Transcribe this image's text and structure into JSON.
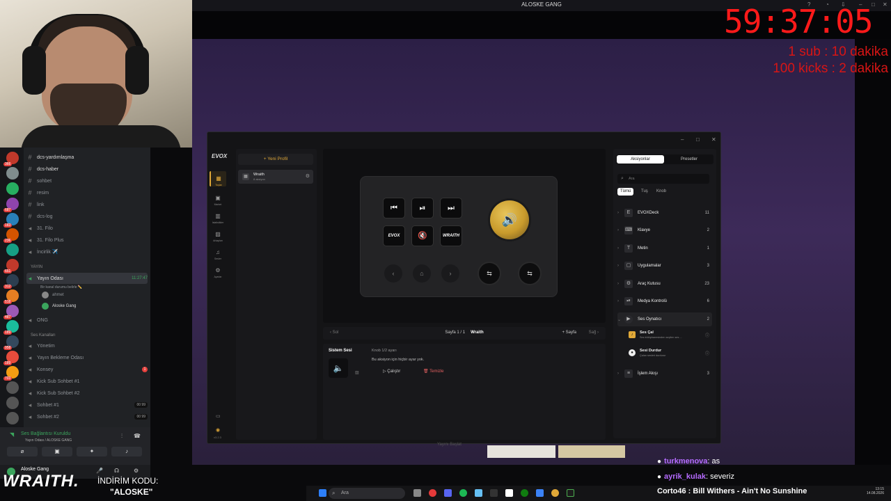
{
  "window_title": "ALOSKE GANG",
  "overlay": {
    "timer": "59:37:05",
    "sub_line1": "1 sub : 10 dakika",
    "sub_line2": "100 kicks : 2 dakika",
    "promo_brand": "WRAITH.",
    "promo_text1": "İNDİRİM KODU:",
    "promo_text2": "\"ALOSKE\"",
    "chat": [
      {
        "user": "turkmenova",
        "msg": ": as"
      },
      {
        "user": "ayrik_kulak",
        "msg": ": severiz"
      }
    ],
    "now_playing": "Corto46 : Bill Withers - Ain't No Sunshine",
    "clock_time": "13:15",
    "clock_date": "14.08.2026",
    "taskbar_search": "Ara"
  },
  "discord": {
    "server_badges": [
      "366",
      "",
      "",
      "687",
      "183",
      "236",
      "",
      "651",
      "312",
      "518",
      "487",
      "189",
      "958",
      "189",
      "703",
      "",
      "",
      ""
    ],
    "channels": [
      {
        "name": "dcs-yardımlaşma",
        "bold": true
      },
      {
        "name": "dcs-haber",
        "bold": true
      },
      {
        "name": "sohbet"
      },
      {
        "name": "resim"
      },
      {
        "name": "link"
      },
      {
        "name": "dcs-log"
      },
      {
        "name": "31. Filo"
      },
      {
        "name": "31. Filo Plus"
      },
      {
        "name": "İncirlik ✈️"
      }
    ],
    "category_live": "YAYIN",
    "live_channel": "Yayın Odası",
    "live_time": "11:27:47",
    "live_status": "Bir kanal durumu belirle ✏️",
    "live_users": [
      "ahmet",
      "Aloske Gang"
    ],
    "ong": "ONG",
    "category_voice": "Ses Kanalları",
    "voice_channels": [
      {
        "name": "Yönetim"
      },
      {
        "name": "Yayın Bekleme Odası"
      },
      {
        "name": "Konsey",
        "badge": "1"
      },
      {
        "name": "Kick Sub Sohbet #1"
      },
      {
        "name": "Kick Sub Sohbet #2"
      },
      {
        "name": "Sohbet #1",
        "count": "00 99"
      },
      {
        "name": "Sohbet #2",
        "count": "00 99"
      }
    ],
    "connection": "Ses Bağlantısı Kuruldu",
    "connection_sub": "Yayın Odası / ALOSKE GANG",
    "username": "Aloske Gang"
  },
  "evox": {
    "logo": "EVOX",
    "rail": [
      {
        "label": "Tuşlar",
        "icon": "▦",
        "active": true
      },
      {
        "label": "Market",
        "icon": "▣"
      },
      {
        "label": "İstatistikler",
        "icon": "▥"
      },
      {
        "label": "Arkaplan",
        "icon": "▨"
      },
      {
        "label": "Sesler",
        "icon": "♫"
      },
      {
        "label": "Ayarlar",
        "icon": "⚙"
      }
    ],
    "version": "v3.2.3",
    "new_profile": "+ Yeni Profil",
    "profile_name": "Wraith",
    "profile_sub": "8 aksiyon",
    "keys_row1": [
      "⏮",
      "⏯",
      "⏭"
    ],
    "keys_row2": [
      "EVOX",
      "🔇",
      "WRAITH"
    ],
    "knob_icon": "🔊",
    "nav": [
      "‹",
      "⌂",
      "›"
    ],
    "knobs": [
      "⇆",
      "⇆"
    ],
    "pagebar": {
      "left": "‹  Sol",
      "center": "Sayfa 1 / 1",
      "profile": "Wraith",
      "add": "+ Sayfa",
      "right": "Sağ  ›"
    },
    "config": {
      "title": "Sistem Sesi",
      "knob_label": "Knob 1/2 ayarı",
      "info": "Bu aksiyon için hiçbir ayar yok.",
      "run": "▷ Çalıştır",
      "clear": "🗑 Temizle"
    },
    "tabs": [
      "Aksiyonlar",
      "Presetler"
    ],
    "search_placeholder": "Ara",
    "filters": [
      "Tümü",
      "Tuş",
      "Knob"
    ],
    "categories": [
      {
        "name": "EVOXDeck",
        "count": "11",
        "icon": "E"
      },
      {
        "name": "Klavye",
        "count": "2",
        "icon": "⌨"
      },
      {
        "name": "Metin",
        "count": "1",
        "icon": "T"
      },
      {
        "name": "Uygulamalar",
        "count": "3",
        "icon": "▢"
      },
      {
        "name": "Araç Kutusu",
        "count": "23",
        "icon": "⚙"
      },
      {
        "name": "Medya Kontrolü",
        "count": "6",
        "icon": "⏯"
      },
      {
        "name": "Ses Oynatıcı",
        "count": "2",
        "icon": "▶",
        "open": true
      },
      {
        "name": "İşlem Akışı",
        "count": "3",
        "icon": "≡"
      }
    ],
    "sub_actions": [
      {
        "name": "Ses Çal",
        "desc": "Ses kütüphanesinden seçilen ses ..."
      },
      {
        "name": "Sesi Durdur",
        "desc": "Çalan sesleri durdurur"
      }
    ],
    "below_text": "Yayını Başlat"
  }
}
